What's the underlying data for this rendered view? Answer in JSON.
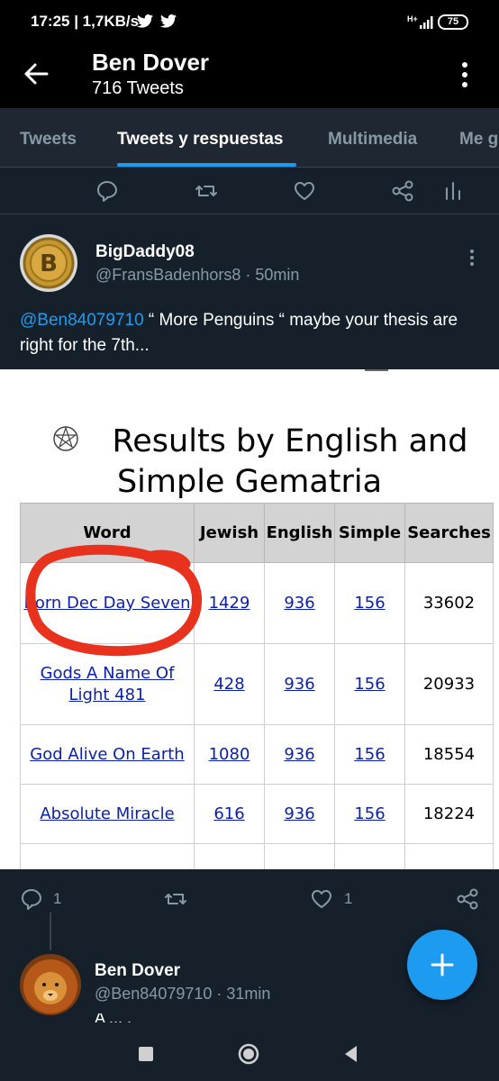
{
  "status_bar": {
    "time": "17:25 | 1,7KB/s",
    "network_label": "H+",
    "battery": "75",
    "icons": [
      "twitter-bird-icon",
      "twitter-bird-icon",
      "signal-icon",
      "battery-icon"
    ]
  },
  "header": {
    "name": "Ben Dover",
    "tweet_count": "716 Tweets"
  },
  "tabs": [
    {
      "label": "Tweets",
      "active": false
    },
    {
      "label": "Tweets y respuestas",
      "active": true
    },
    {
      "label": "Multimedia",
      "active": false
    },
    {
      "label": "Me g",
      "active": false
    }
  ],
  "tweet": {
    "display_name": "BigDaddy08",
    "handle_time": "@FransBadenhors8 · 50min",
    "mention": "@Ben84079710",
    "text": " “ More Penguins “ maybe your thesis are right for the 7th...",
    "media": {
      "title_line1": "Results by English and",
      "title_line2": "Simple Gematria",
      "table": {
        "headers": [
          "Word",
          "Jewish",
          "English",
          "Simple",
          "Searches"
        ],
        "rows": [
          {
            "word": "Born Dec Day Seven",
            "jewish": "1429",
            "english": "936",
            "simple": "156",
            "searches": "33602"
          },
          {
            "word": "Gods A Name Of Light 481",
            "jewish": "428",
            "english": "936",
            "simple": "156",
            "searches": "20933"
          },
          {
            "word": "God Alive On Earth",
            "jewish": "1080",
            "english": "936",
            "simple": "156",
            "searches": "18554"
          },
          {
            "word": "Absolute Miracle",
            "jewish": "616",
            "english": "936",
            "simple": "156",
            "searches": "18224"
          }
        ]
      }
    },
    "reply_count": "1",
    "like_count": "1"
  },
  "tweet2": {
    "display_name": "Ben Dover",
    "handle_time": "@Ben84079710 · 31min",
    "text_stub": "A ... ."
  },
  "colors": {
    "background": "#15202b",
    "accent": "#1d9bf0",
    "muted": "#8899a6",
    "annotation_red": "#e8321e"
  }
}
